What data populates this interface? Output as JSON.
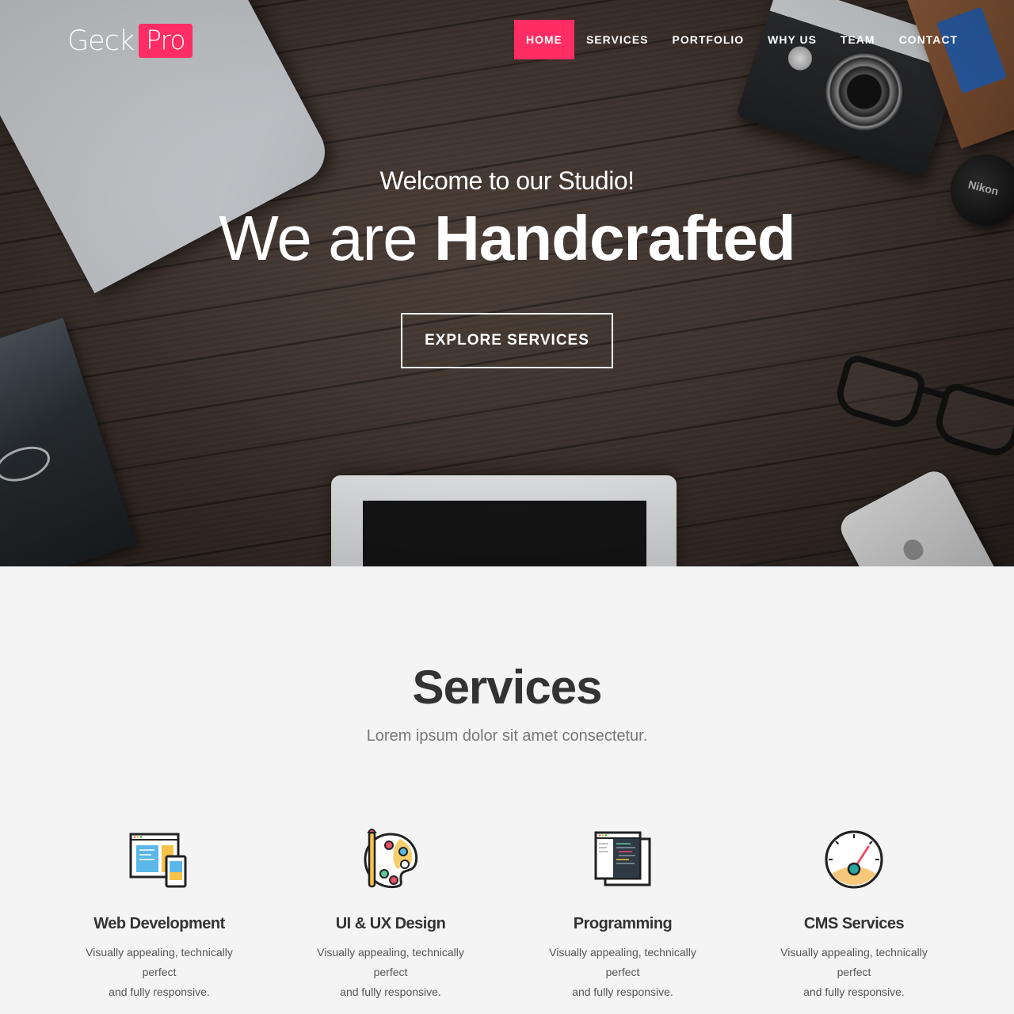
{
  "brand": {
    "name_part1": "Geck",
    "name_part2": "Pro",
    "accent": "#ff2d63"
  },
  "nav": {
    "items": [
      {
        "label": "HOME",
        "active": true
      },
      {
        "label": "SERVICES",
        "active": false
      },
      {
        "label": "PORTFOLIO",
        "active": false
      },
      {
        "label": "WHY US",
        "active": false
      },
      {
        "label": "TEAM",
        "active": false
      },
      {
        "label": "CONTACT",
        "active": false
      }
    ]
  },
  "hero": {
    "welcome": "Welcome to our Studio!",
    "title_light": "We are",
    "title_bold": "Handcrafted",
    "cta_label": "EXPLORE SERVICES"
  },
  "services": {
    "title": "Services",
    "subtitle": "Lorem ipsum dolor sit amet consectetur.",
    "items": [
      {
        "icon": "web-development-icon",
        "title": "Web Development",
        "desc_line1": "Visually appealing, technically perfect",
        "desc_line2": "and fully responsive."
      },
      {
        "icon": "paint-palette-icon",
        "title": "UI & UX Design",
        "desc_line1": "Visually appealing, technically perfect",
        "desc_line2": "and fully responsive."
      },
      {
        "icon": "code-editor-icon",
        "title": "Programming",
        "desc_line1": "Visually appealing, technically perfect",
        "desc_line2": "and fully responsive."
      },
      {
        "icon": "speedometer-icon",
        "title": "CMS Services",
        "desc_line1": "Visually appealing, technically perfect",
        "desc_line2": "and fully responsive."
      }
    ]
  },
  "props": {
    "lens_cap_text": "Nikon"
  }
}
